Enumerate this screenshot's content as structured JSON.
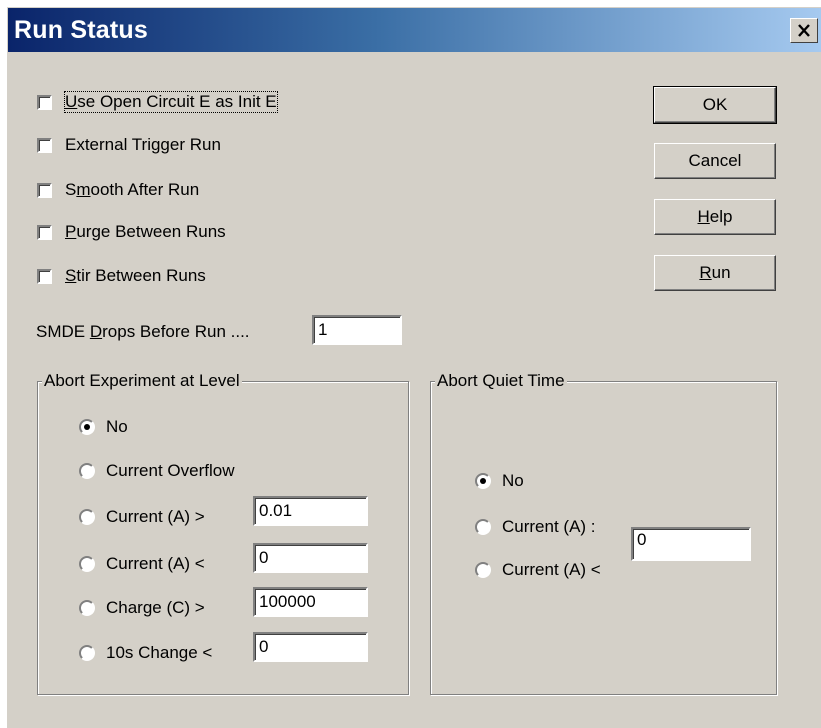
{
  "window": {
    "title": "Run Status",
    "close_glyph": "✕"
  },
  "checkboxes": [
    {
      "label": "Use Open Circuit E as Init E",
      "checked": false
    },
    {
      "label": "External Trigger Run",
      "checked": false
    },
    {
      "label_pre": "S",
      "label_u": "m",
      "label_post": "ooth After Run",
      "checked": false
    },
    {
      "label_pre": "",
      "label_u": "P",
      "label_post": "urge Between Runs",
      "checked": false
    },
    {
      "label_pre": "",
      "label_u": "S",
      "label_post": "tir Between Runs",
      "checked": false
    }
  ],
  "buttons": {
    "ok": "OK",
    "cancel": "Cancel",
    "help_u": "H",
    "help_rest": "elp",
    "run_u": "R",
    "run_rest": "un"
  },
  "smde": {
    "label_pre": "SMDE ",
    "label_u": "D",
    "label_post": "rops Before Run ....",
    "value": "1"
  },
  "abort_level": {
    "title": "Abort Experiment at Level",
    "options": [
      {
        "label": "No",
        "selected": true
      },
      {
        "label": "Current Overflow",
        "selected": false
      },
      {
        "label": "Current (A) >",
        "selected": false,
        "value": "0.01"
      },
      {
        "label": "Current (A) <",
        "selected": false,
        "value": "0"
      },
      {
        "label": "Charge (C) >",
        "selected": false,
        "value": "100000"
      },
      {
        "label": "10s Change <",
        "selected": false,
        "value": "0"
      }
    ]
  },
  "abort_quiet": {
    "title": "Abort Quiet Time",
    "options": [
      {
        "label": "No",
        "selected": true
      },
      {
        "label": "Current (A) :",
        "selected": false
      },
      {
        "label": "Current (A) <",
        "selected": false
      }
    ],
    "value": "0"
  }
}
